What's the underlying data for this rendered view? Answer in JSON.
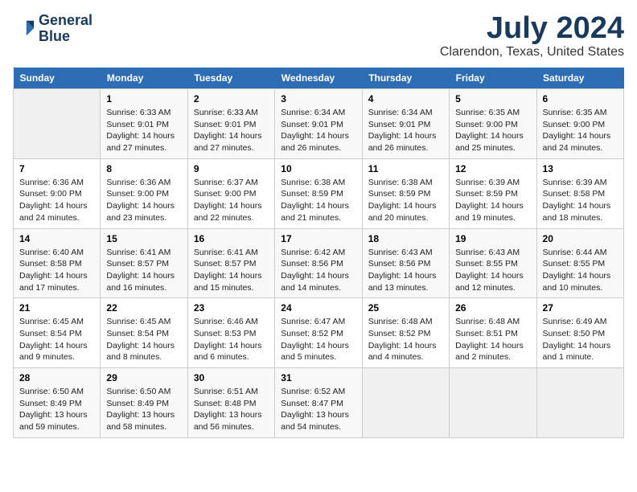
{
  "header": {
    "logo_line1": "General",
    "logo_line2": "Blue",
    "month": "July 2024",
    "location": "Clarendon, Texas, United States"
  },
  "weekdays": [
    "Sunday",
    "Monday",
    "Tuesday",
    "Wednesday",
    "Thursday",
    "Friday",
    "Saturday"
  ],
  "weeks": [
    [
      {
        "day": "",
        "detail": ""
      },
      {
        "day": "1",
        "detail": "Sunrise: 6:33 AM\nSunset: 9:01 PM\nDaylight: 14 hours\nand 27 minutes."
      },
      {
        "day": "2",
        "detail": "Sunrise: 6:33 AM\nSunset: 9:01 PM\nDaylight: 14 hours\nand 27 minutes."
      },
      {
        "day": "3",
        "detail": "Sunrise: 6:34 AM\nSunset: 9:01 PM\nDaylight: 14 hours\nand 26 minutes."
      },
      {
        "day": "4",
        "detail": "Sunrise: 6:34 AM\nSunset: 9:01 PM\nDaylight: 14 hours\nand 26 minutes."
      },
      {
        "day": "5",
        "detail": "Sunrise: 6:35 AM\nSunset: 9:00 PM\nDaylight: 14 hours\nand 25 minutes."
      },
      {
        "day": "6",
        "detail": "Sunrise: 6:35 AM\nSunset: 9:00 PM\nDaylight: 14 hours\nand 24 minutes."
      }
    ],
    [
      {
        "day": "7",
        "detail": "Sunrise: 6:36 AM\nSunset: 9:00 PM\nDaylight: 14 hours\nand 24 minutes."
      },
      {
        "day": "8",
        "detail": "Sunrise: 6:36 AM\nSunset: 9:00 PM\nDaylight: 14 hours\nand 23 minutes."
      },
      {
        "day": "9",
        "detail": "Sunrise: 6:37 AM\nSunset: 9:00 PM\nDaylight: 14 hours\nand 22 minutes."
      },
      {
        "day": "10",
        "detail": "Sunrise: 6:38 AM\nSunset: 8:59 PM\nDaylight: 14 hours\nand 21 minutes."
      },
      {
        "day": "11",
        "detail": "Sunrise: 6:38 AM\nSunset: 8:59 PM\nDaylight: 14 hours\nand 20 minutes."
      },
      {
        "day": "12",
        "detail": "Sunrise: 6:39 AM\nSunset: 8:59 PM\nDaylight: 14 hours\nand 19 minutes."
      },
      {
        "day": "13",
        "detail": "Sunrise: 6:39 AM\nSunset: 8:58 PM\nDaylight: 14 hours\nand 18 minutes."
      }
    ],
    [
      {
        "day": "14",
        "detail": "Sunrise: 6:40 AM\nSunset: 8:58 PM\nDaylight: 14 hours\nand 17 minutes."
      },
      {
        "day": "15",
        "detail": "Sunrise: 6:41 AM\nSunset: 8:57 PM\nDaylight: 14 hours\nand 16 minutes."
      },
      {
        "day": "16",
        "detail": "Sunrise: 6:41 AM\nSunset: 8:57 PM\nDaylight: 14 hours\nand 15 minutes."
      },
      {
        "day": "17",
        "detail": "Sunrise: 6:42 AM\nSunset: 8:56 PM\nDaylight: 14 hours\nand 14 minutes."
      },
      {
        "day": "18",
        "detail": "Sunrise: 6:43 AM\nSunset: 8:56 PM\nDaylight: 14 hours\nand 13 minutes."
      },
      {
        "day": "19",
        "detail": "Sunrise: 6:43 AM\nSunset: 8:55 PM\nDaylight: 14 hours\nand 12 minutes."
      },
      {
        "day": "20",
        "detail": "Sunrise: 6:44 AM\nSunset: 8:55 PM\nDaylight: 14 hours\nand 10 minutes."
      }
    ],
    [
      {
        "day": "21",
        "detail": "Sunrise: 6:45 AM\nSunset: 8:54 PM\nDaylight: 14 hours\nand 9 minutes."
      },
      {
        "day": "22",
        "detail": "Sunrise: 6:45 AM\nSunset: 8:54 PM\nDaylight: 14 hours\nand 8 minutes."
      },
      {
        "day": "23",
        "detail": "Sunrise: 6:46 AM\nSunset: 8:53 PM\nDaylight: 14 hours\nand 6 minutes."
      },
      {
        "day": "24",
        "detail": "Sunrise: 6:47 AM\nSunset: 8:52 PM\nDaylight: 14 hours\nand 5 minutes."
      },
      {
        "day": "25",
        "detail": "Sunrise: 6:48 AM\nSunset: 8:52 PM\nDaylight: 14 hours\nand 4 minutes."
      },
      {
        "day": "26",
        "detail": "Sunrise: 6:48 AM\nSunset: 8:51 PM\nDaylight: 14 hours\nand 2 minutes."
      },
      {
        "day": "27",
        "detail": "Sunrise: 6:49 AM\nSunset: 8:50 PM\nDaylight: 14 hours\nand 1 minute."
      }
    ],
    [
      {
        "day": "28",
        "detail": "Sunrise: 6:50 AM\nSunset: 8:49 PM\nDaylight: 13 hours\nand 59 minutes."
      },
      {
        "day": "29",
        "detail": "Sunrise: 6:50 AM\nSunset: 8:49 PM\nDaylight: 13 hours\nand 58 minutes."
      },
      {
        "day": "30",
        "detail": "Sunrise: 6:51 AM\nSunset: 8:48 PM\nDaylight: 13 hours\nand 56 minutes."
      },
      {
        "day": "31",
        "detail": "Sunrise: 6:52 AM\nSunset: 8:47 PM\nDaylight: 13 hours\nand 54 minutes."
      },
      {
        "day": "",
        "detail": ""
      },
      {
        "day": "",
        "detail": ""
      },
      {
        "day": "",
        "detail": ""
      }
    ]
  ]
}
